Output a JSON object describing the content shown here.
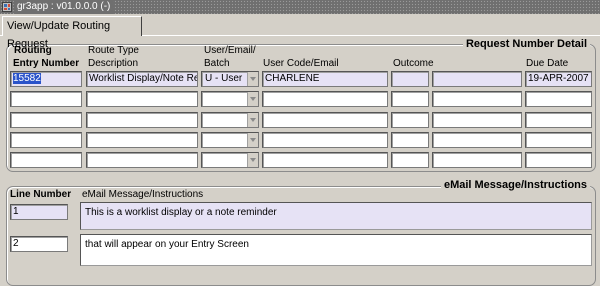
{
  "window": {
    "title": "gr3app : v01.0.0.0 (-)"
  },
  "tab": {
    "label": "View/Update Routing Request"
  },
  "request_detail": {
    "title": "Request Number Detail",
    "headers": {
      "routing_line1": "Routing",
      "routing_line2": "Entry Number",
      "route_type_line1": "Route Type",
      "route_type_line2": "Description",
      "user_line1": "User/Email/",
      "user_line2": "Batch",
      "user_code": "User Code/Email",
      "outcome": "Outcome",
      "due_date": "Due Date"
    },
    "rows": [
      {
        "entry_number": "15582",
        "route_type": "Worklist Display/Note Re",
        "batch": "U - User",
        "user_code": "CHARLENE",
        "outcome": "",
        "extra": "",
        "due_date": "19-APR-2007"
      },
      {
        "entry_number": "",
        "route_type": "",
        "batch": "",
        "user_code": "",
        "outcome": "",
        "extra": "",
        "due_date": ""
      },
      {
        "entry_number": "",
        "route_type": "",
        "batch": "",
        "user_code": "",
        "outcome": "",
        "extra": "",
        "due_date": ""
      },
      {
        "entry_number": "",
        "route_type": "",
        "batch": "",
        "user_code": "",
        "outcome": "",
        "extra": "",
        "due_date": ""
      },
      {
        "entry_number": "",
        "route_type": "",
        "batch": "",
        "user_code": "",
        "outcome": "",
        "extra": "",
        "due_date": ""
      }
    ]
  },
  "email_section": {
    "title": "eMail Message/Instructions",
    "line_number_label": "Line Number",
    "message_label": "eMail Message/Instructions",
    "lines": [
      {
        "line_number": "1",
        "text": "This is a worklist display or a note reminder"
      },
      {
        "line_number": "2",
        "text": "that will appear on your Entry Screen"
      }
    ]
  },
  "icons": {
    "app": "app-icon",
    "dropdown": "chevron-down-icon"
  }
}
